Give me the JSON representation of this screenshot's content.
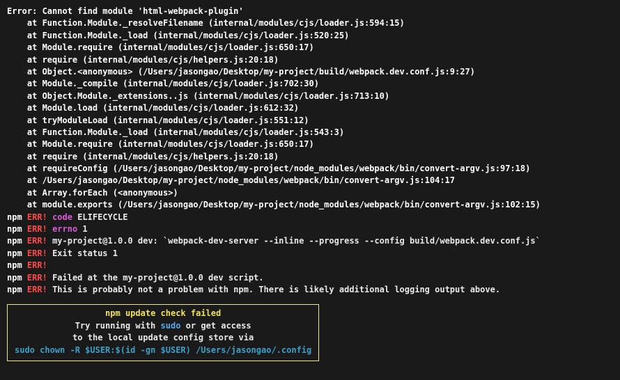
{
  "error_header": "Error: Cannot find module 'html-webpack-plugin'",
  "stack": [
    "    at Function.Module._resolveFilename (internal/modules/cjs/loader.js:594:15)",
    "    at Function.Module._load (internal/modules/cjs/loader.js:520:25)",
    "    at Module.require (internal/modules/cjs/loader.js:650:17)",
    "    at require (internal/modules/cjs/helpers.js:20:18)",
    "    at Object.<anonymous> (/Users/jasongao/Desktop/my-project/build/webpack.dev.conf.js:9:27)",
    "    at Module._compile (internal/modules/cjs/loader.js:702:30)",
    "    at Object.Module._extensions..js (internal/modules/cjs/loader.js:713:10)",
    "    at Module.load (internal/modules/cjs/loader.js:612:32)",
    "    at tryModuleLoad (internal/modules/cjs/loader.js:551:12)",
    "    at Function.Module._load (internal/modules/cjs/loader.js:543:3)",
    "    at Module.require (internal/modules/cjs/loader.js:650:17)",
    "    at require (internal/modules/cjs/helpers.js:20:18)",
    "    at requireConfig (/Users/jasongao/Desktop/my-project/node_modules/webpack/bin/convert-argv.js:97:18)",
    "    at /Users/jasongao/Desktop/my-project/node_modules/webpack/bin/convert-argv.js:104:17",
    "    at Array.forEach (<anonymous>)",
    "    at module.exports (/Users/jasongao/Desktop/my-project/node_modules/webpack/bin/convert-argv.js:102:15)"
  ],
  "npm_lines": [
    {
      "npm": "npm",
      "err": "ERR!",
      "key": "code",
      "rest": "ELIFECYCLE"
    },
    {
      "npm": "npm",
      "err": "ERR!",
      "key": "errno",
      "rest": "1"
    },
    {
      "npm": "npm",
      "err": "ERR!",
      "key": "",
      "rest": "my-project@1.0.0 dev: `webpack-dev-server --inline --progress --config build/webpack.dev.conf.js`"
    },
    {
      "npm": "npm",
      "err": "ERR!",
      "key": "",
      "rest": "Exit status 1"
    },
    {
      "npm": "npm",
      "err": "ERR!",
      "key": "",
      "rest": ""
    },
    {
      "npm": "npm",
      "err": "ERR!",
      "key": "",
      "rest": "Failed at the my-project@1.0.0 dev script."
    },
    {
      "npm": "npm",
      "err": "ERR!",
      "key": "",
      "rest": "This is probably not a problem with npm. There is likely additional logging output above."
    }
  ],
  "update_box": {
    "title": "npm update check failed",
    "line2_pre": "Try running with ",
    "line2_sudo": "sudo",
    "line2_post": " or get access",
    "line3": "to the local update config store via",
    "cmd": "sudo chown -R $USER:$(id -gn $USER) /Users/jasongao/.config"
  }
}
